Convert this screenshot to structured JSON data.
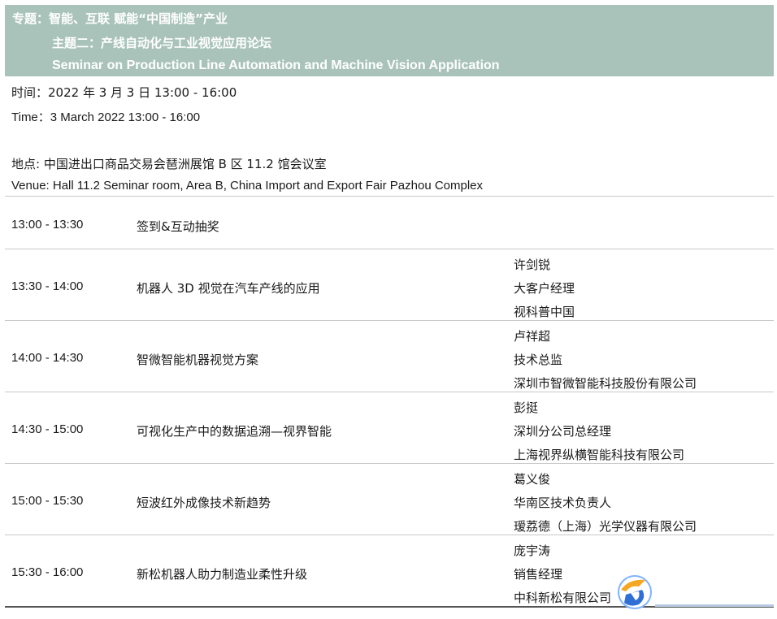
{
  "header": {
    "line1": "专题：智能、互联  赋能“中国制造”产业",
    "line2": "主题二：产线自动化与工业视觉应用论坛",
    "line3": "Seminar on Production Line Automation and Machine Vision Application"
  },
  "info": {
    "time_cn": "时间：2022 年 3 月 3 日  13:00 - 16:00",
    "time_en": "Time：3 March 2022 13:00 - 16:00",
    "venue_cn": "地点:  中国进出口商品交易会琶洲展馆  B 区 11.2 馆会议室",
    "venue_en": "Venue: Hall 11.2 Seminar room, Area B, China Import and Export Fair Pazhou Complex"
  },
  "schedule": [
    {
      "time": "13:00 - 13:30",
      "topic": "签到&互动抽奖",
      "speaker": []
    },
    {
      "time": "13:30 - 14:00",
      "topic": "机器人 3D 视觉在汽车产线的应用",
      "speaker": [
        "许剑锐",
        "大客户经理",
        "视科普中国"
      ]
    },
    {
      "time": "14:00 - 14:30",
      "topic": "智微智能机器视觉方案",
      "speaker": [
        "卢祥超",
        "技术总监",
        "深圳市智微智能科技股份有限公司"
      ]
    },
    {
      "time": "14:30 - 15:00",
      "topic": "可视化生产中的数据追溯—视界智能",
      "speaker": [
        "彭挺",
        "深圳分公司总经理",
        "上海视界纵横智能科技有限公司"
      ]
    },
    {
      "time": "15:00 - 15:30",
      "topic": "短波红外成像技术新趋势",
      "speaker": [
        "葛义俊",
        "华南区技术负责人",
        "瑷荔德（上海）光学仪器有限公司"
      ]
    },
    {
      "time": "15:30 - 16:00",
      "topic": "新松机器人助力制造业柔性升级",
      "speaker": [
        "庞宇涛",
        "销售经理",
        "中科新松有限公司"
      ]
    }
  ],
  "logo": {
    "icon": "logo-icon",
    "colors": [
      "#f5a623",
      "#2f6fd6",
      "#7fb3ff"
    ]
  }
}
